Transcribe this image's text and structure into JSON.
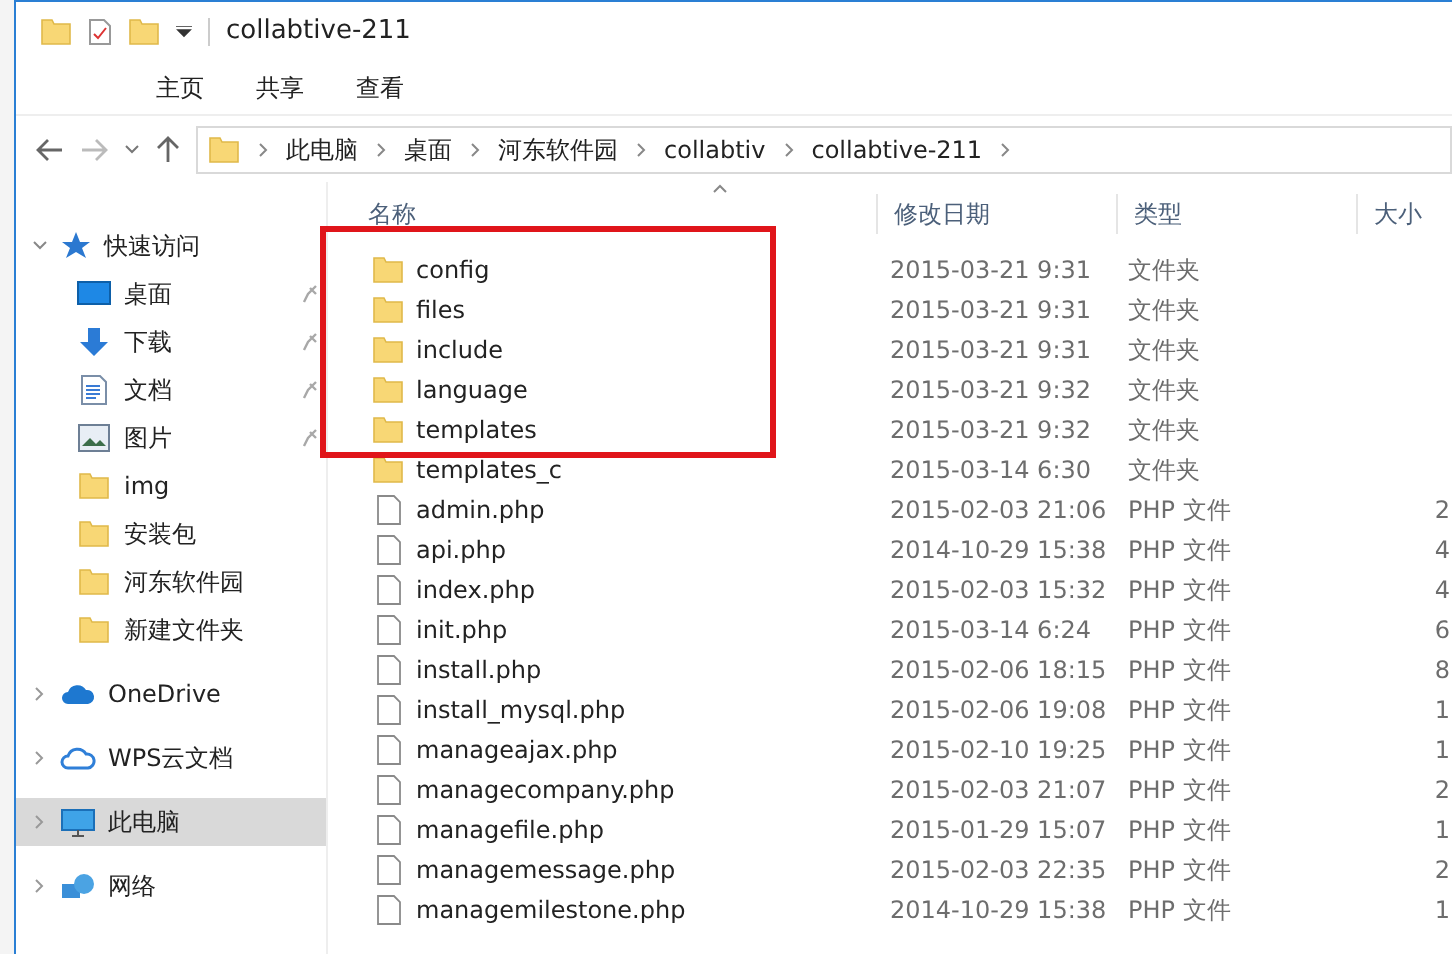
{
  "window": {
    "title": "collabtive-211"
  },
  "ribbon_tabs": [
    "主页",
    "共享",
    "查看"
  ],
  "breadcrumb": [
    "此电脑",
    "桌面",
    "河东软件园",
    "collabtiv",
    "collabtive-211"
  ],
  "columns": [
    "名称",
    "修改日期",
    "类型",
    "大小"
  ],
  "sidebar": {
    "items": [
      {
        "label": "快速访问",
        "kind": "star",
        "expanded": true,
        "selected": false,
        "children": [
          {
            "label": "桌面",
            "kind": "desktop",
            "pinned": true
          },
          {
            "label": "下载",
            "kind": "download",
            "pinned": true
          },
          {
            "label": "文档",
            "kind": "document",
            "pinned": true
          },
          {
            "label": "图片",
            "kind": "image",
            "pinned": true
          },
          {
            "label": "img",
            "kind": "folder",
            "pinned": false
          },
          {
            "label": "安装包",
            "kind": "folder",
            "pinned": false
          },
          {
            "label": "河东软件园",
            "kind": "folder",
            "pinned": false
          },
          {
            "label": "新建文件夹",
            "kind": "folder",
            "pinned": false
          }
        ]
      },
      {
        "label": "OneDrive",
        "kind": "cloud",
        "expanded": false,
        "selected": false
      },
      {
        "label": "WPS云文档",
        "kind": "cloud-outline",
        "expanded": false,
        "selected": false
      },
      {
        "label": "此电脑",
        "kind": "pc",
        "expanded": false,
        "selected": true
      },
      {
        "label": "网络",
        "kind": "network",
        "expanded": false,
        "selected": false
      }
    ]
  },
  "rows": [
    {
      "name": "config",
      "kind": "folder",
      "date": "2015-03-21 9:31",
      "type": "文件夹",
      "highlighted": true
    },
    {
      "name": "files",
      "kind": "folder",
      "date": "2015-03-21 9:31",
      "type": "文件夹",
      "highlighted": true
    },
    {
      "name": "include",
      "kind": "folder",
      "date": "2015-03-21 9:31",
      "type": "文件夹",
      "highlighted": true
    },
    {
      "name": "language",
      "kind": "folder",
      "date": "2015-03-21 9:32",
      "type": "文件夹",
      "highlighted": true
    },
    {
      "name": "templates",
      "kind": "folder",
      "date": "2015-03-21 9:32",
      "type": "文件夹",
      "highlighted": true
    },
    {
      "name": "templates_c",
      "kind": "folder",
      "date": "2015-03-14 6:30",
      "type": "文件夹",
      "highlighted": false
    },
    {
      "name": "admin.php",
      "kind": "file",
      "date": "2015-02-03 21:06",
      "type": "PHP 文件",
      "size": "2",
      "highlighted": false
    },
    {
      "name": "api.php",
      "kind": "file",
      "date": "2014-10-29 15:38",
      "type": "PHP 文件",
      "size": "4",
      "highlighted": false
    },
    {
      "name": "index.php",
      "kind": "file",
      "date": "2015-02-03 15:32",
      "type": "PHP 文件",
      "size": "4",
      "highlighted": false
    },
    {
      "name": "init.php",
      "kind": "file",
      "date": "2015-03-14 6:24",
      "type": "PHP 文件",
      "size": "6",
      "highlighted": false
    },
    {
      "name": "install.php",
      "kind": "file",
      "date": "2015-02-06 18:15",
      "type": "PHP 文件",
      "size": "8",
      "highlighted": false
    },
    {
      "name": "install_mysql.php",
      "kind": "file",
      "date": "2015-02-06 19:08",
      "type": "PHP 文件",
      "size": "1",
      "highlighted": false
    },
    {
      "name": "manageajax.php",
      "kind": "file",
      "date": "2015-02-10 19:25",
      "type": "PHP 文件",
      "size": "1",
      "highlighted": false
    },
    {
      "name": "managecompany.php",
      "kind": "file",
      "date": "2015-02-03 21:07",
      "type": "PHP 文件",
      "size": "2",
      "highlighted": false
    },
    {
      "name": "managefile.php",
      "kind": "file",
      "date": "2015-01-29 15:07",
      "type": "PHP 文件",
      "size": "1",
      "highlighted": false
    },
    {
      "name": "managemessage.php",
      "kind": "file",
      "date": "2015-02-03 22:35",
      "type": "PHP 文件",
      "size": "2",
      "highlighted": false
    },
    {
      "name": "managemilestone.php",
      "kind": "file",
      "date": "2014-10-29 15:38",
      "type": "PHP 文件",
      "size": "1",
      "highlighted": false
    }
  ]
}
